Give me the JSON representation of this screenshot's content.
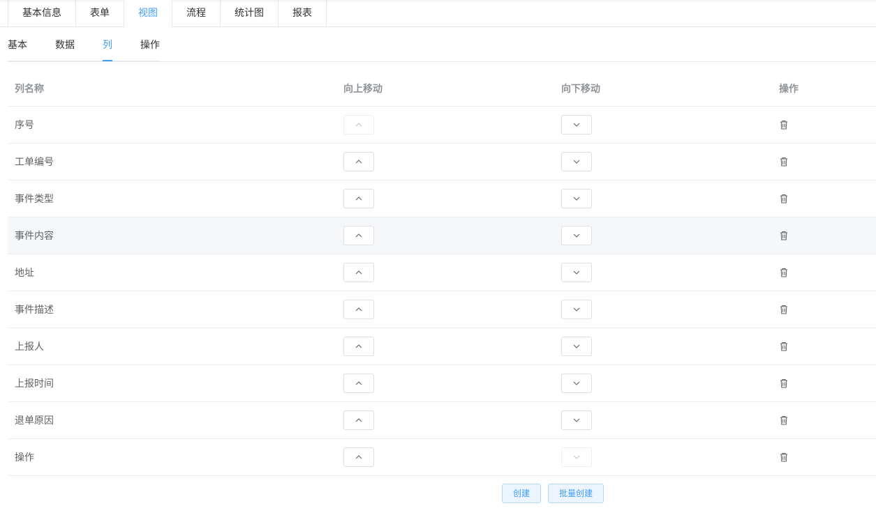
{
  "top_tabs": [
    {
      "label": "基本信息",
      "active": false
    },
    {
      "label": "表单",
      "active": false
    },
    {
      "label": "视图",
      "active": true
    },
    {
      "label": "流程",
      "active": false
    },
    {
      "label": "统计图",
      "active": false
    },
    {
      "label": "报表",
      "active": false
    }
  ],
  "sub_tabs": [
    {
      "label": "基本",
      "active": false
    },
    {
      "label": "数据",
      "active": false
    },
    {
      "label": "列",
      "active": true
    },
    {
      "label": "操作",
      "active": false
    }
  ],
  "table": {
    "headers": {
      "name": "列名称",
      "move_up": "向上移动",
      "move_down": "向下移动",
      "actions": "操作"
    },
    "rows": [
      {
        "name": "序号",
        "up_disabled": true,
        "down_disabled": false
      },
      {
        "name": "工单编号",
        "up_disabled": false,
        "down_disabled": false
      },
      {
        "name": "事件类型",
        "up_disabled": false,
        "down_disabled": false
      },
      {
        "name": "事件内容",
        "up_disabled": false,
        "down_disabled": false,
        "hovered": true
      },
      {
        "name": "地址",
        "up_disabled": false,
        "down_disabled": false
      },
      {
        "name": "事件描述",
        "up_disabled": false,
        "down_disabled": false
      },
      {
        "name": "上报人",
        "up_disabled": false,
        "down_disabled": false
      },
      {
        "name": "上报时间",
        "up_disabled": false,
        "down_disabled": false
      },
      {
        "name": "退单原因",
        "up_disabled": false,
        "down_disabled": false
      },
      {
        "name": "操作",
        "up_disabled": false,
        "down_disabled": true
      }
    ]
  },
  "buttons": {
    "create": "创建",
    "batch_create": "批量创建"
  },
  "icons": {
    "move_up": "chevron-up-icon",
    "move_down": "chevron-down-icon",
    "delete": "trash-icon"
  },
  "colors": {
    "accent": "#409eff",
    "border": "#ebeef5",
    "hover_row": "#f5f7fa"
  }
}
